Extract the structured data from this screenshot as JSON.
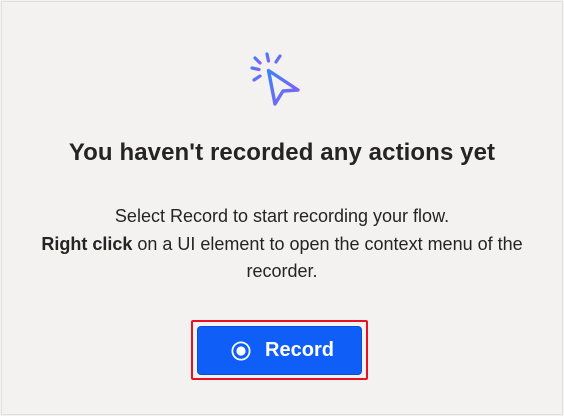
{
  "empty_state": {
    "icon": "cursor-click-icon",
    "title": "You haven't recorded any actions yet",
    "description": {
      "line1": "Select Record to start recording your flow.",
      "bold_phrase": "Right click",
      "line2_rest": " on a UI element to open the context menu of the recorder."
    }
  },
  "record_button": {
    "icon": "record-icon",
    "label": "Record"
  },
  "colors": {
    "background": "#f3f2f1",
    "button_blue": "#0f5ef7",
    "highlight_red": "#e81123",
    "icon_gradient_start": "#3b82f6",
    "icon_gradient_end": "#8b5cf6"
  }
}
